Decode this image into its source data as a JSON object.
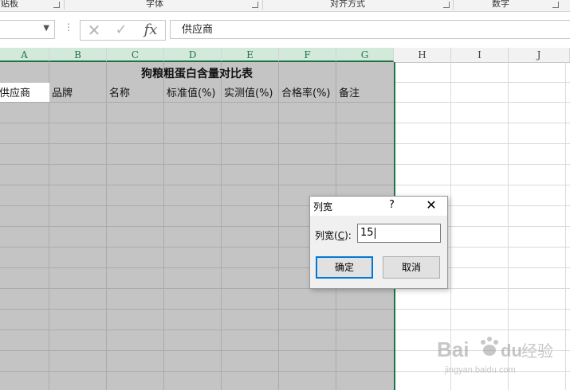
{
  "ribbon": {
    "groups": [
      "剪贴板",
      "字体",
      "对齐方式",
      "数字"
    ]
  },
  "formula_bar": {
    "name_box_value": "",
    "cancel_symbol": "✕",
    "enter_symbol": "✓",
    "fx_label": "fx",
    "formula_value": "供应商"
  },
  "columns": [
    "A",
    "B",
    "C",
    "D",
    "E",
    "F",
    "G",
    "H",
    "I",
    "J"
  ],
  "sheet": {
    "title": "狗粮粗蛋白含量对比表",
    "headers": [
      "供应商",
      "品牌",
      "名称",
      "标准值(%)",
      "实测值(%)",
      "合格率(%)",
      "备注"
    ]
  },
  "dialog": {
    "title": "列宽",
    "help": "?",
    "close": "✕",
    "label_prefix": "列宽(",
    "label_hotkey": "C",
    "label_suffix": "):",
    "value": "15",
    "ok_label": "确定",
    "cancel_label": "取消"
  },
  "watermark": {
    "brand": "Bai",
    "cn": "经验",
    "url": "jingyan.baidu.com"
  },
  "colors": {
    "accent": "#217346",
    "selection": "#c4c4c4",
    "dialog_focus": "#0078d7"
  }
}
